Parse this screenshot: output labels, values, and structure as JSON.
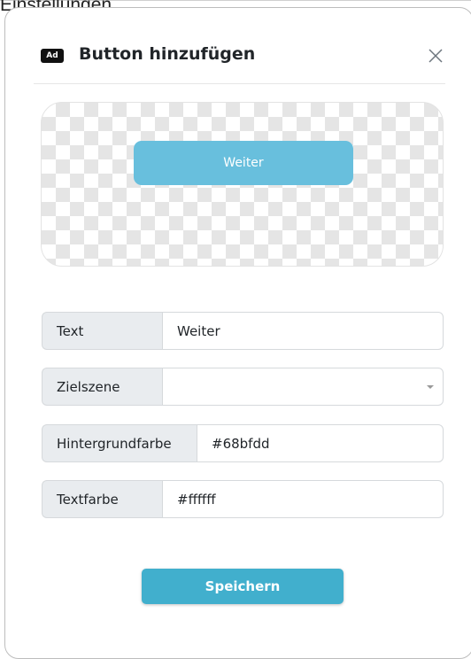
{
  "background": {
    "partial_text": "Einstellungen."
  },
  "modal": {
    "badge": "Ad",
    "title": "Button hinzufügen",
    "close_icon": "close-icon",
    "preview": {
      "button_label": "Weiter",
      "button_color": "#68bfdd",
      "text_color": "#ffffff"
    },
    "fields": {
      "text": {
        "label": "Text",
        "value": "Weiter"
      },
      "target_scene": {
        "label": "Zielszene",
        "value": ""
      },
      "background_color": {
        "label": "Hintergrundfarbe",
        "value": "#68bfdd"
      },
      "text_color": {
        "label": "Textfarbe",
        "value": "#ffffff"
      }
    },
    "save_label": "Speichern",
    "save_color": "#41afcd"
  }
}
